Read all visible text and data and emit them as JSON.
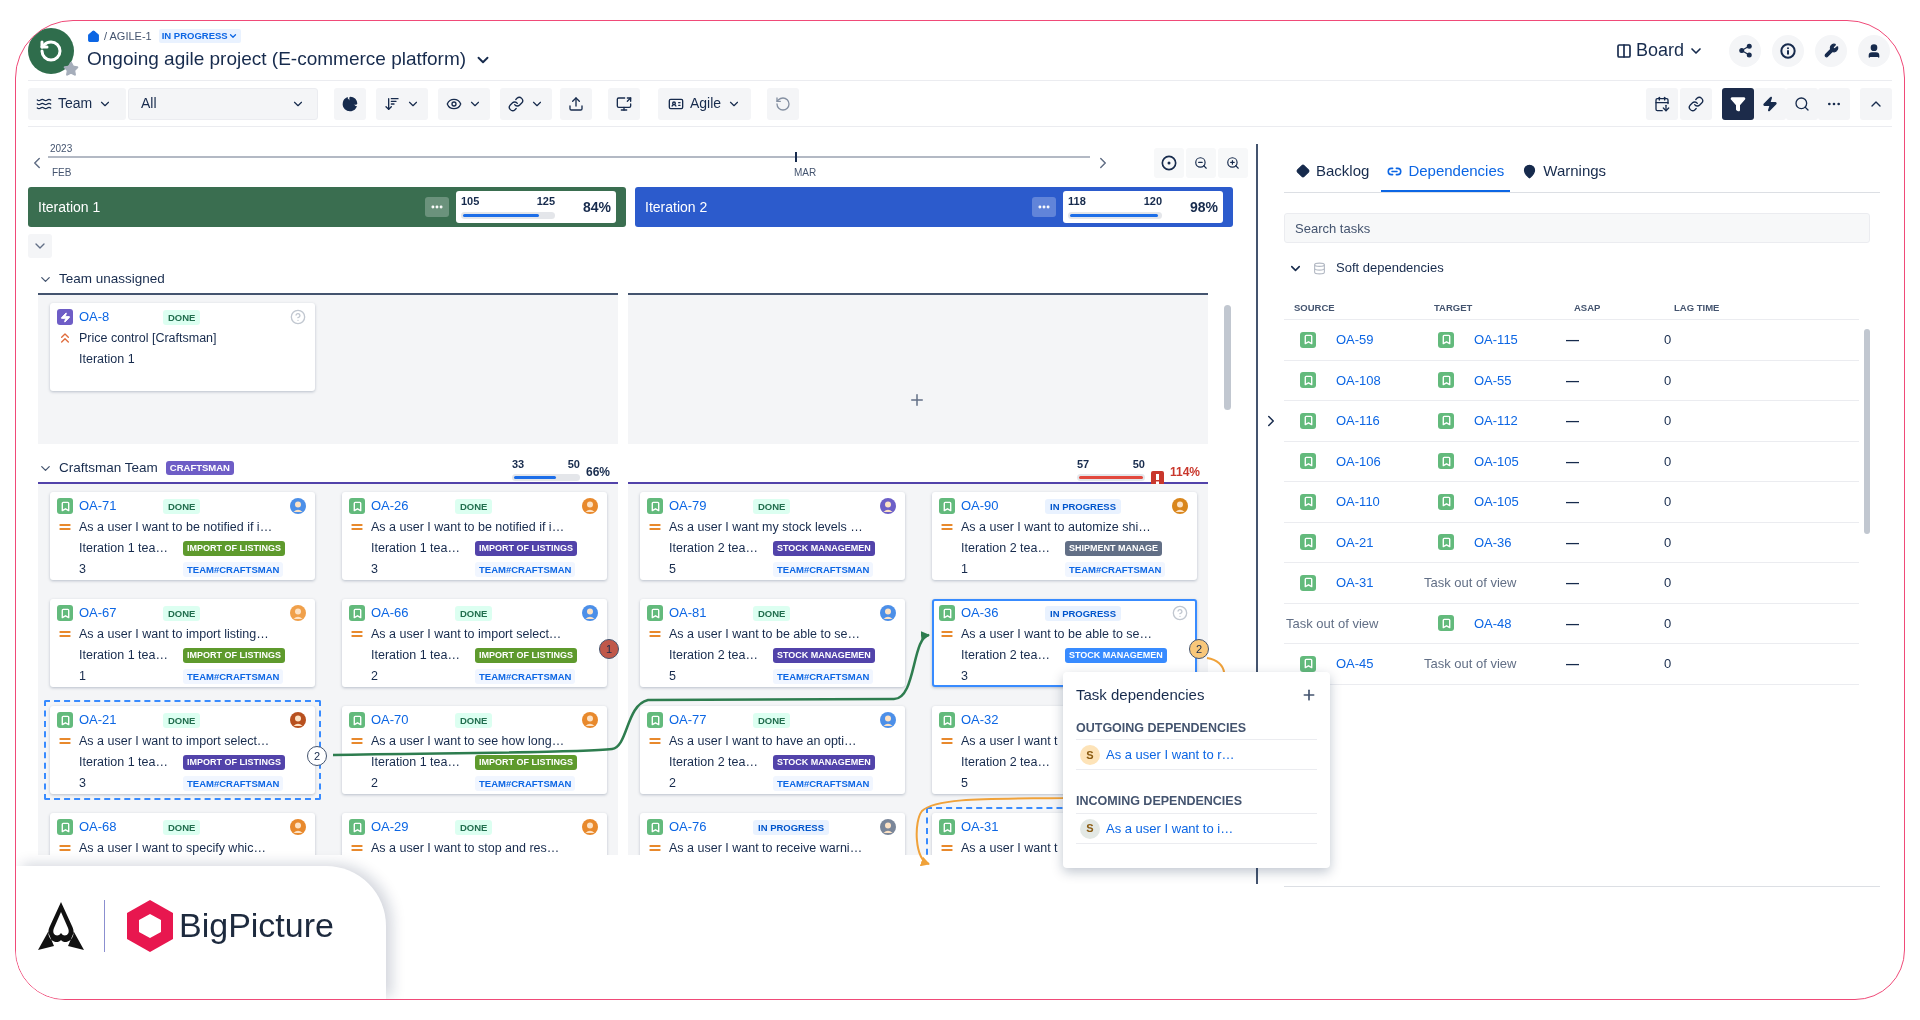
{
  "breadcrumb": {
    "path": "/ AGILE-1",
    "status": "IN PROGRESS"
  },
  "title": "Ongoing agile project (E-commerce platform)",
  "view_switch": "Board",
  "toolbar": {
    "team_label": "Team",
    "team_filter": "All",
    "mode": "Agile",
    "filter_on": true
  },
  "timeline": {
    "year": "2023",
    "months": [
      "FEB",
      "MAR"
    ]
  },
  "iterations": [
    {
      "name": "Iteration 1",
      "color": "#3a6e50",
      "done": "105",
      "capacity": "125",
      "percent": "84%",
      "level": 0.84
    },
    {
      "name": "Iteration 2",
      "color": "#2c5bcc",
      "done": "118",
      "capacity": "120",
      "percent": "98%",
      "level": 0.98
    }
  ],
  "lanes": [
    {
      "name": "Team unassigned",
      "expanded": true,
      "columns": [
        {
          "cards": [
            {
              "key": "OA-8",
              "icon": {
                "kind": "bolt"
              },
              "priority": {
                "kind": "highest"
              },
              "status": {
                "text": "DONE",
                "kind": "done"
              },
              "summary": "Price control [Craftsman]",
              "iteration": "Iteration 1",
              "selected": false,
              "focused": false
            }
          ]
        },
        {}
      ]
    },
    {
      "name": "Craftsman Team",
      "tag": "CRAFTSMAN",
      "expanded": true,
      "columns": [
        {
          "capacity": {
            "done": "33",
            "capacity": "50",
            "percent": "66%",
            "level": 0.66,
            "over": false
          },
          "cards": [
            {
              "key": "OA-71",
              "icon": {
                "kind": "story"
              },
              "priority": {
                "kind": "medium"
              },
              "status": {
                "text": "DONE",
                "kind": "done"
              },
              "avatar": {
                "color": "#4c8fe8"
              },
              "summary": "As a user I want to be notified if i…",
              "iteration": "Iteration 1 tea…",
              "label": {
                "text": "IMPORT OF LISTINGS",
                "color": "#5e9a2d"
              },
              "points": "3",
              "team": "TEAM#CRAFTSMAN",
              "selected": false,
              "focused": false
            },
            {
              "key": "OA-26",
              "icon": {
                "kind": "story"
              },
              "priority": {
                "kind": "medium"
              },
              "status": {
                "text": "DONE",
                "kind": "done"
              },
              "avatar": {
                "color": "#e8892c"
              },
              "summary": "As a user I want to be notified if i…",
              "iteration": "Iteration 1 tea…",
              "label": {
                "text": "IMPORT OF LISTINGS",
                "color": "#5243aa"
              },
              "points": "3",
              "team": "TEAM#CRAFTSMAN",
              "selected": false,
              "focused": false
            },
            {
              "key": "OA-67",
              "icon": {
                "kind": "story"
              },
              "priority": {
                "kind": "medium"
              },
              "status": {
                "text": "DONE",
                "kind": "done"
              },
              "avatar": {
                "color": "#f0a04a"
              },
              "summary": "As a user I want to import listing…",
              "iteration": "Iteration 1 tea…",
              "label": {
                "text": "IMPORT OF LISTINGS",
                "color": "#5e9a2d"
              },
              "points": "1",
              "team": "TEAM#CRAFTSMAN",
              "selected": false,
              "focused": false
            },
            {
              "key": "OA-66",
              "icon": {
                "kind": "story"
              },
              "priority": {
                "kind": "medium"
              },
              "status": {
                "text": "DONE",
                "kind": "done"
              },
              "avatar": {
                "color": "#4c8fe8"
              },
              "summary": "As a user I want to import select…",
              "iteration": "Iteration 1 tea…",
              "label": {
                "text": "IMPORT OF LISTINGS",
                "color": "#5e9a2d"
              },
              "points": "2",
              "team": "TEAM#CRAFTSMAN",
              "selected": false,
              "focused": false,
              "dep_badge": {
                "text": "1",
                "color": "#c0584a"
              }
            },
            {
              "key": "OA-21",
              "icon": {
                "kind": "story"
              },
              "priority": {
                "kind": "medium"
              },
              "status": {
                "text": "DONE",
                "kind": "done"
              },
              "avatar": {
                "color": "#b8501e"
              },
              "summary": "As a user I want to import select…",
              "iteration": "Iteration 1 tea…",
              "label": {
                "text": "IMPORT OF LISTINGS",
                "color": "#5243aa"
              },
              "points": "3",
              "team": "TEAM#CRAFTSMAN",
              "selected": true,
              "focused": false,
              "dep_badge": {
                "text": "2",
                "color": "#ffffff"
              }
            },
            {
              "key": "OA-70",
              "icon": {
                "kind": "story"
              },
              "priority": {
                "kind": "medium"
              },
              "status": {
                "text": "DONE",
                "kind": "done"
              },
              "avatar": {
                "color": "#e8892c"
              },
              "summary": "As a user I want to see how long…",
              "iteration": "Iteration 1 tea…",
              "label": {
                "text": "IMPORT OF LISTINGS",
                "color": "#5e9a2d"
              },
              "points": "2",
              "team": "TEAM#CRAFTSMAN",
              "selected": false,
              "focused": false
            },
            {
              "key": "OA-68",
              "icon": {
                "kind": "story"
              },
              "priority": {
                "kind": "medium"
              },
              "status": {
                "text": "DONE",
                "kind": "done"
              },
              "avatar": {
                "color": "#e8892c"
              },
              "summary": "As a user I want to specify whic…",
              "selected": false,
              "focused": false
            },
            {
              "key": "OA-29",
              "icon": {
                "kind": "story"
              },
              "priority": {
                "kind": "medium"
              },
              "status": {
                "text": "DONE",
                "kind": "done"
              },
              "avatar": {
                "color": "#e8892c"
              },
              "summary": "As a user I want to stop and res…",
              "selected": false,
              "focused": false
            }
          ]
        },
        {
          "capacity": {
            "done": "57",
            "capacity": "50",
            "percent": "114%",
            "level": 1,
            "over": true
          },
          "cards": [
            {
              "key": "OA-79",
              "icon": {
                "kind": "story"
              },
              "priority": {
                "kind": "medium"
              },
              "status": {
                "text": "DONE",
                "kind": "done"
              },
              "avatar": {
                "color": "#6c5fc7"
              },
              "summary": "As a user I want my stock levels …",
              "iteration": "Iteration 2 tea…",
              "label": {
                "text": "STOCK MANAGEMEN",
                "color": "#5243aa"
              },
              "points": "5",
              "team": "TEAM#CRAFTSMAN",
              "selected": false,
              "focused": false
            },
            {
              "key": "OA-90",
              "icon": {
                "kind": "story"
              },
              "priority": {
                "kind": "medium"
              },
              "status": {
                "text": "IN PROGRESS",
                "kind": "progress"
              },
              "avatar": {
                "color": "#d9861c"
              },
              "summary": "As a user I want to automize shi…",
              "iteration": "Iteration 2 tea…",
              "label": {
                "text": "SHIPMENT MANAGE",
                "color": "#626f86"
              },
              "points": "1",
              "team": "TEAM#CRAFTSMAN",
              "selected": false,
              "focused": false
            },
            {
              "key": "OA-81",
              "icon": {
                "kind": "story"
              },
              "priority": {
                "kind": "medium"
              },
              "status": {
                "text": "DONE",
                "kind": "done"
              },
              "avatar": {
                "color": "#4c8fe8"
              },
              "summary": "As a user I want to be able to se…",
              "iteration": "Iteration 2 tea…",
              "label": {
                "text": "STOCK MANAGEMEN",
                "color": "#5243aa"
              },
              "points": "5",
              "team": "TEAM#CRAFTSMAN",
              "selected": false,
              "focused": false
            },
            {
              "key": "OA-36",
              "icon": {
                "kind": "story"
              },
              "priority": {
                "kind": "medium"
              },
              "status": {
                "text": "IN PROGRESS",
                "kind": "progress"
              },
              "summary": "As a user I want to be able to se…",
              "iteration": "Iteration 2 tea…",
              "label": {
                "text": "STOCK MANAGEMEN",
                "color": "#388bff"
              },
              "points": "3",
              "selected": false,
              "focused": true,
              "dep_badge": {
                "text": "2",
                "color": "#f8c77a"
              }
            },
            {
              "key": "OA-77",
              "icon": {
                "kind": "story"
              },
              "priority": {
                "kind": "medium"
              },
              "status": {
                "text": "DONE",
                "kind": "done"
              },
              "avatar": {
                "color": "#4c8fe8"
              },
              "summary": "As a user I want to have an opti…",
              "iteration": "Iteration 2 tea…",
              "label": {
                "text": "STOCK MANAGEMEN",
                "color": "#5243aa"
              },
              "points": "2",
              "team": "TEAM#CRAFTSMAN",
              "selected": false,
              "focused": false
            },
            {
              "key": "OA-32",
              "icon": {
                "kind": "story"
              },
              "priority": {
                "kind": "medium"
              },
              "summary": "As a user I want t",
              "iteration": "Iteration 2 tea…",
              "points": "5",
              "selected": false,
              "focused": false
            },
            {
              "key": "OA-76",
              "icon": {
                "kind": "story"
              },
              "priority": {
                "kind": "medium"
              },
              "status": {
                "text": "IN PROGRESS",
                "kind": "progress"
              },
              "avatar": {
                "color": "#7a8699"
              },
              "summary": "As a user I want to receive warni…",
              "selected": false,
              "focused": false
            },
            {
              "key": "OA-31",
              "icon": {
                "kind": "story"
              },
              "priority": {
                "kind": "medium"
              },
              "summary": "As a user I want t",
              "selected": true,
              "focused": false
            }
          ]
        }
      ]
    }
  ],
  "panel": {
    "tabs": [
      {
        "label": "Backlog",
        "selected": false
      },
      {
        "label": "Dependencies",
        "selected": true
      },
      {
        "label": "Warnings",
        "selected": false
      }
    ],
    "search_placeholder": "Search tasks",
    "group": {
      "name": "Soft dependencies",
      "expanded": true
    },
    "columns": [
      "SOURCE",
      "TARGET",
      "ASAP",
      "LAG TIME"
    ],
    "rows": [
      {
        "source": {
          "key": "OA-59",
          "in_view": true
        },
        "target": {
          "key": "OA-115",
          "in_view": true
        },
        "asap": "—",
        "lag": "0"
      },
      {
        "source": {
          "key": "OA-108",
          "in_view": true
        },
        "target": {
          "key": "OA-55",
          "in_view": true
        },
        "asap": "—",
        "lag": "0"
      },
      {
        "source": {
          "key": "OA-116",
          "in_view": true
        },
        "target": {
          "key": "OA-112",
          "in_view": true
        },
        "asap": "—",
        "lag": "0"
      },
      {
        "source": {
          "key": "OA-106",
          "in_view": true
        },
        "target": {
          "key": "OA-105",
          "in_view": true
        },
        "asap": "—",
        "lag": "0"
      },
      {
        "source": {
          "key": "OA-110",
          "in_view": true
        },
        "target": {
          "key": "OA-105",
          "in_view": true
        },
        "asap": "—",
        "lag": "0"
      },
      {
        "source": {
          "key": "OA-21",
          "in_view": true
        },
        "target": {
          "key": "OA-36",
          "in_view": true
        },
        "asap": "—",
        "lag": "0"
      },
      {
        "source": {
          "key": "OA-31",
          "in_view": true
        },
        "target": {
          "key": "Task out of view",
          "in_view": false
        },
        "asap": "—",
        "lag": "0"
      },
      {
        "source": {
          "key": "Task out of view",
          "in_view": false
        },
        "target": {
          "key": "OA-48",
          "in_view": true
        },
        "asap": "—",
        "lag": "0"
      },
      {
        "source": {
          "key": "OA-45",
          "in_view": true
        },
        "target": {
          "key": "Task out of view",
          "in_view": false
        },
        "asap": "—",
        "lag": "0"
      }
    ]
  },
  "popup": {
    "title": "Task dependencies",
    "sections": [
      {
        "heading": "OUTGOING DEPENDENCIES",
        "items": [
          {
            "initial": "S",
            "text": "As a user I want to r…",
            "color": "#fde3b8"
          }
        ]
      },
      {
        "heading": "INCOMING DEPENDENCIES",
        "items": [
          {
            "initial": "S",
            "text": "As a user I want to i…",
            "color": "#e3e8e4"
          }
        ]
      }
    ]
  },
  "brand": {
    "name": "BigPicture"
  }
}
